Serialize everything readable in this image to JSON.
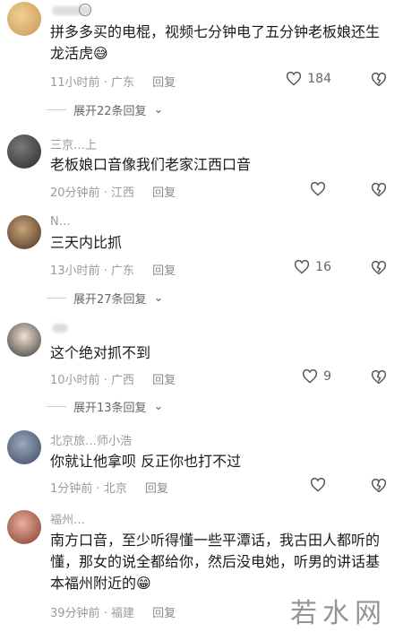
{
  "comments": [
    {
      "text": "拼多多买的电棍，视频七分钟电了五分钟老板娘还生龙活虎😅",
      "time": "11小时前",
      "location": "广东",
      "reply": "回复",
      "likes": "184",
      "expand": "展开22条回复",
      "avatar_color": "#d9b07a"
    },
    {
      "username": "三京…上",
      "text": "老板娘口音像我们老家江西口音",
      "time": "20分钟前",
      "location": "江西",
      "reply": "回复",
      "likes": "",
      "avatar_color": "#4a4a4a"
    },
    {
      "username": "N…",
      "text": "三天内比抓",
      "time": "13小时前",
      "location": "广东",
      "reply": "回复",
      "likes": "16",
      "expand": "展开27条回复",
      "avatar_color": "#7a5a3a"
    },
    {
      "username": "",
      "text": "这个绝对抓不到",
      "time": "10小时前",
      "location": "广西",
      "reply": "回复",
      "likes": "9",
      "expand": "展开13条回复",
      "avatar_color": "#6e6e6e"
    },
    {
      "username": "北京旅…师小浩",
      "text": "你就让他拿呗  反正你也打不过",
      "time": "1分钟前",
      "location": "北京",
      "reply": "回复",
      "likes": "",
      "avatar_color": "#5a6a80"
    },
    {
      "username": "福州…",
      "text": "南方口音，至少听得懂一些平潭话，我古田人都听的懂，那女的说全都给你，然后没电她，听男的讲话基本福州附近的😁",
      "time": "39分钟前",
      "location": "福建",
      "reply": "回复",
      "likes": "",
      "avatar_color": "#b86a5a"
    }
  ],
  "watermark": "若水网",
  "separator": "·"
}
